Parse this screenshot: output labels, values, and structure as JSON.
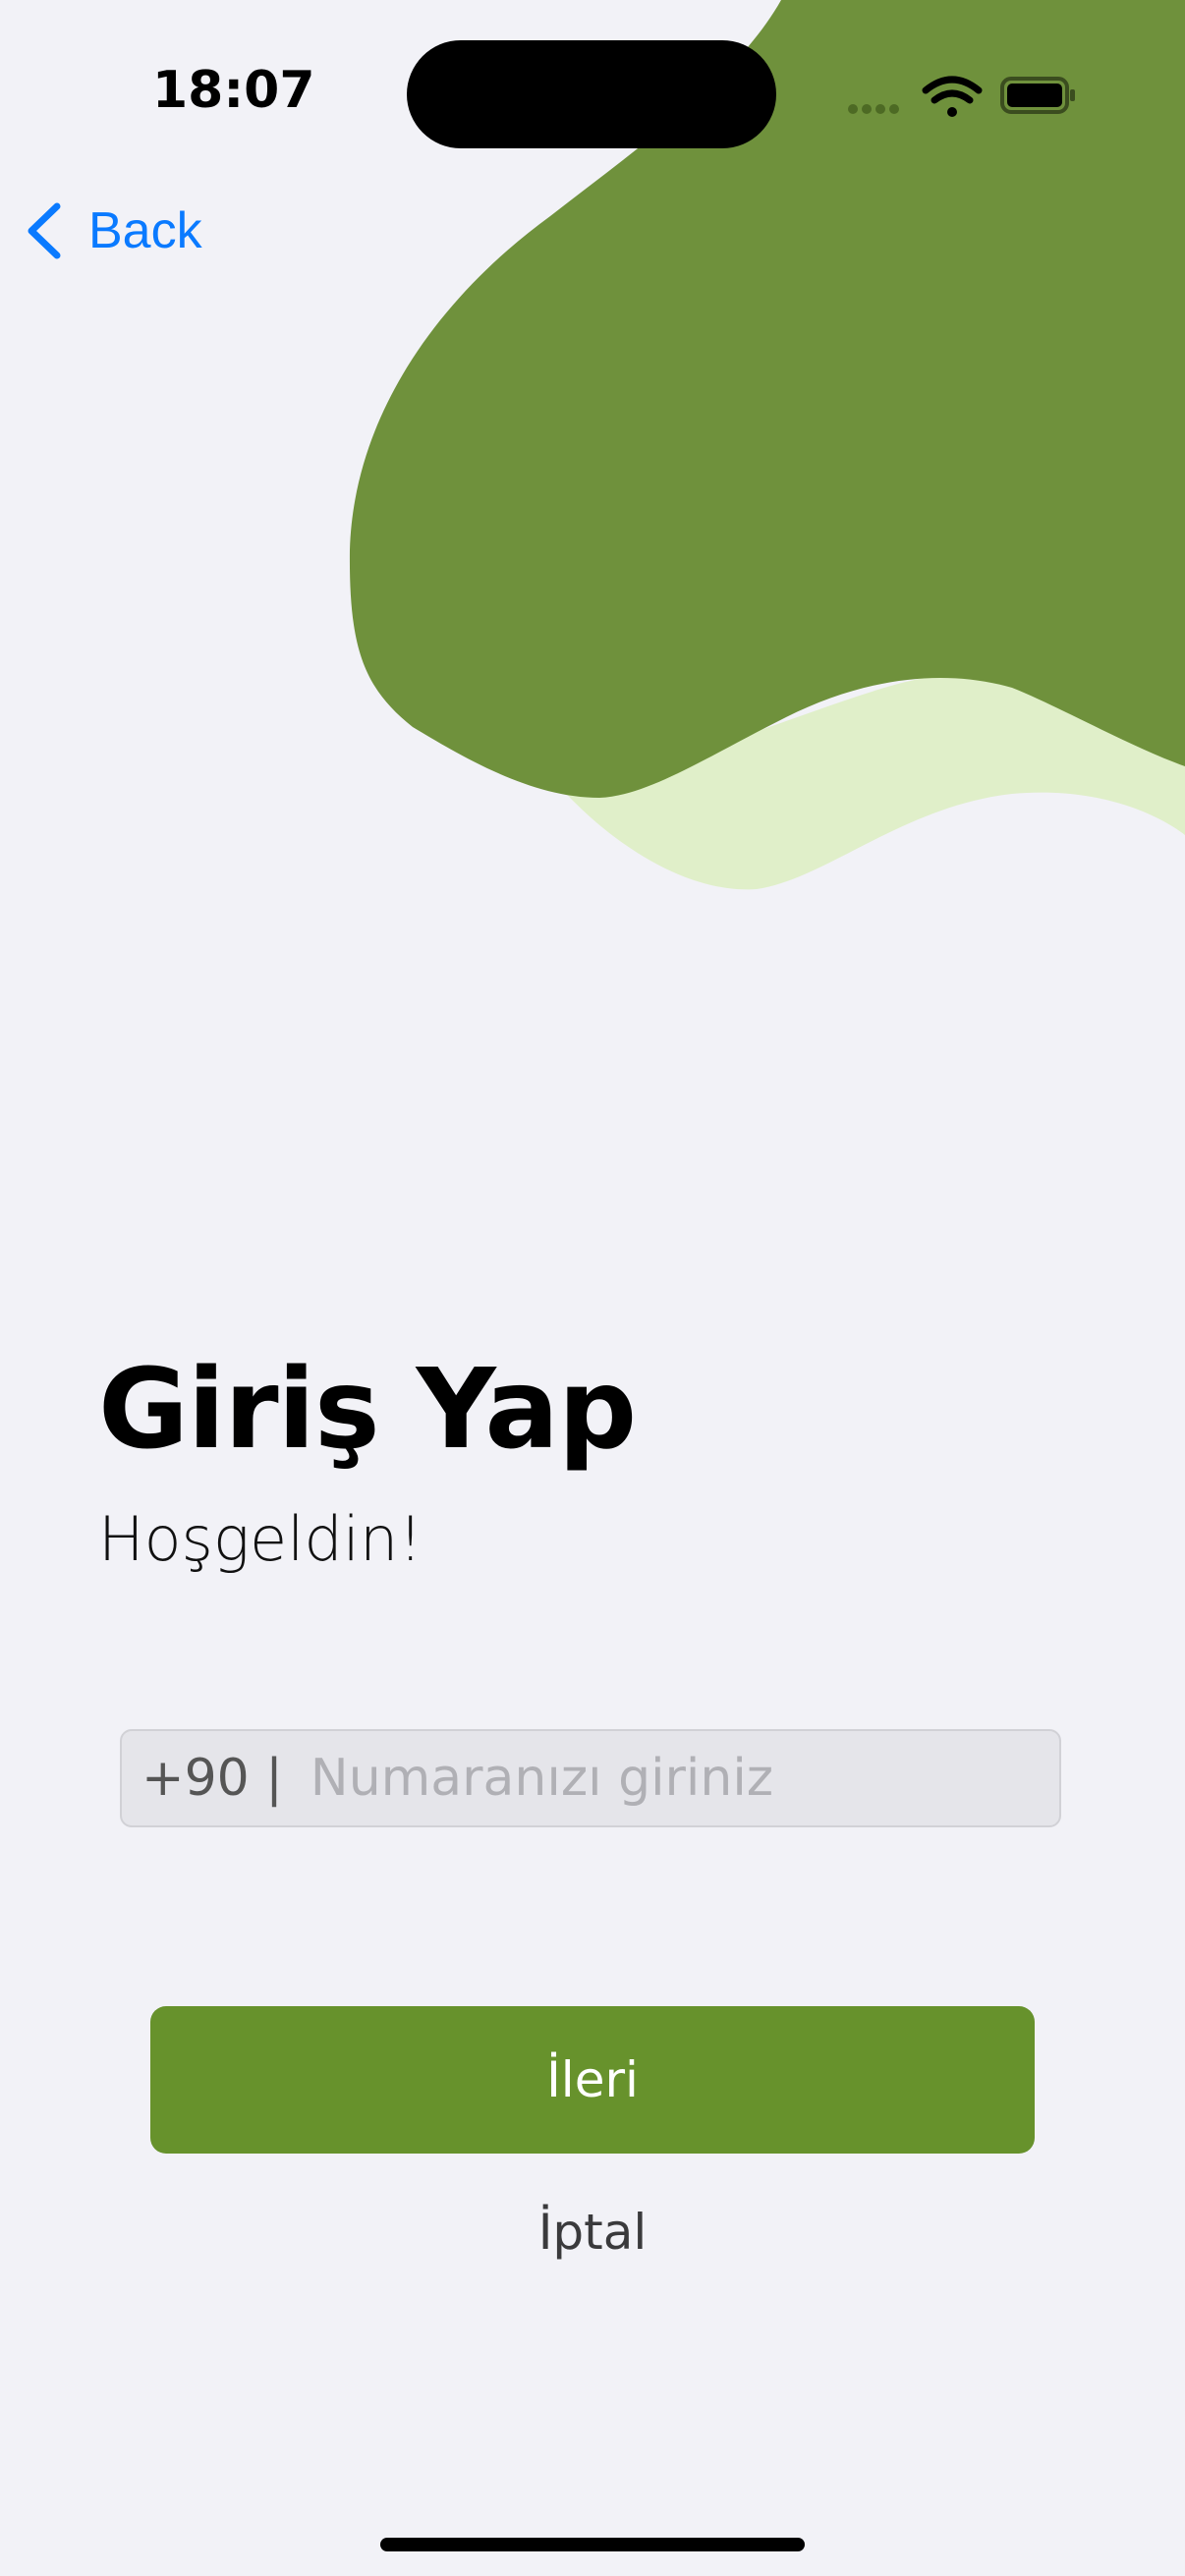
{
  "status_bar": {
    "time": "18:07",
    "icons": [
      "signal-dots-icon",
      "wifi-icon",
      "battery-icon"
    ]
  },
  "nav": {
    "back_label": "Back"
  },
  "login": {
    "title": "Giriş Yap",
    "subtitle": "Hoşgeldin!",
    "phone_prefix": "+90 |",
    "phone_placeholder": "Numaranızı giriniz",
    "phone_value": "",
    "next_label": "İleri",
    "cancel_label": "İptal"
  },
  "colors": {
    "background": "#f2f2f7",
    "blob_dark": "#6f913c",
    "blob_light": "#e0efc9",
    "primary_button": "#67922c",
    "link_blue": "#0a7aff"
  }
}
